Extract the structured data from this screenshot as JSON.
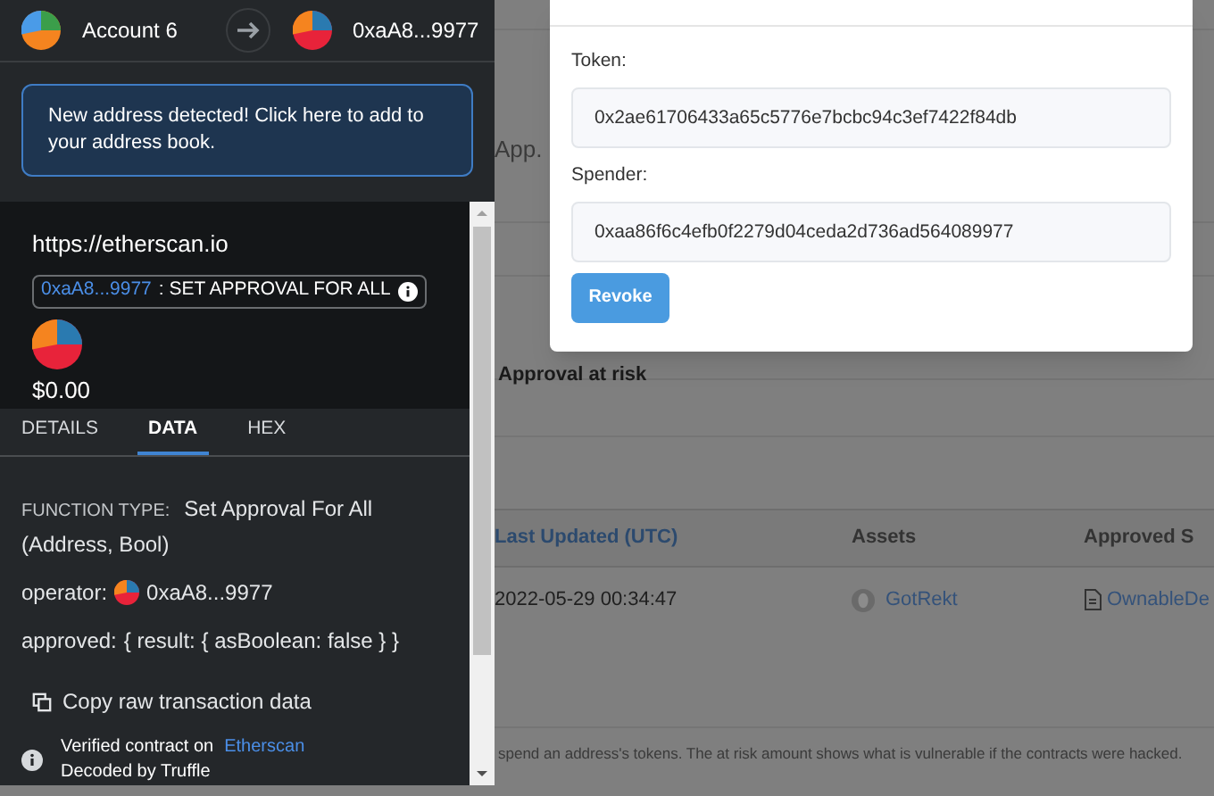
{
  "wallet": {
    "from_account": "Account 6",
    "to_address": "0xaA8...9977",
    "notice": "New address detected! Click here to add to your address book.",
    "origin": "https://etherscan.io",
    "contract_address": "0xaA8...9977",
    "method": ": SET APPROVAL FOR ALL",
    "amount": "$0.00",
    "tabs": [
      {
        "label": "DETAILS",
        "selected": false
      },
      {
        "label": "DATA",
        "selected": true
      },
      {
        "label": "HEX",
        "selected": false
      }
    ],
    "function_type_label": "FUNCTION TYPE:",
    "function_type": "Set Approval For All (Address, Bool)",
    "params": [
      {
        "name": "operator:",
        "kind": "address",
        "value": "0xaA8...9977"
      },
      {
        "name": "approved:",
        "kind": "text",
        "value": "{ result: { asBoolean: false } }"
      }
    ],
    "copy_label": "Copy raw transaction data",
    "verified_text": "Verified contract on",
    "verified_link": "Etherscan",
    "decoded": "Decoded by Truffle"
  },
  "page": {
    "heading_fragment": "App.",
    "section_title": "Approval at risk",
    "table": {
      "columns": [
        "Last Updated (UTC)",
        "Assets",
        "Approved S"
      ],
      "rows": [
        {
          "last_updated": "2022-05-29 00:34:47",
          "asset": "GotRekt",
          "spender": "OwnableDe"
        }
      ]
    },
    "footer_note": "spend an address's tokens. The at risk amount shows what is vulnerable if the contracts were hacked."
  },
  "modal": {
    "fields": [
      {
        "label": "Token:",
        "value": "0x2ae61706433a65c5776e7bcbc94c3ef7422f84db"
      },
      {
        "label": "Spender:",
        "value": "0xaa86f6c4efb0f2279d04ceda2d736ad564089977"
      }
    ],
    "button": "Revoke"
  }
}
